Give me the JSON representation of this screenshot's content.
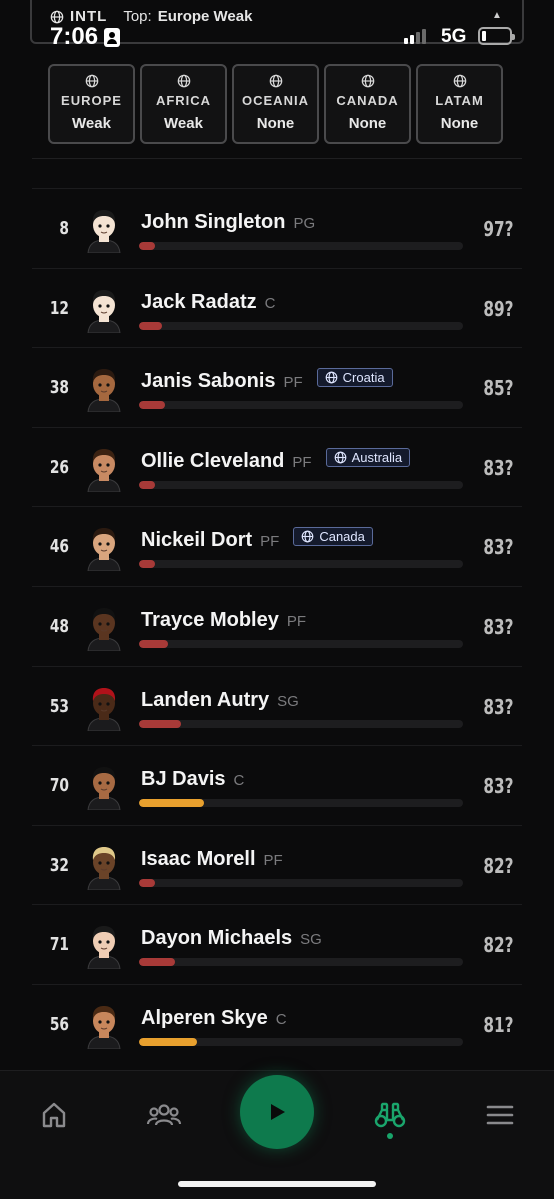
{
  "status": {
    "region": "INTL",
    "top_label": "Top:",
    "top_value": "Europe Weak",
    "time": "7:06",
    "network": "5G"
  },
  "regions": [
    {
      "name": "EUROPE",
      "state": "Weak"
    },
    {
      "name": "AFRICA",
      "state": "Weak"
    },
    {
      "name": "OCEANIA",
      "state": "None"
    },
    {
      "name": "CANADA",
      "state": "None"
    },
    {
      "name": "LATAM",
      "state": "None"
    }
  ],
  "colors": {
    "bar_red": "#a83a38",
    "bar_gold": "#e8a02e",
    "accent_green": "#0e7a4d"
  },
  "players": [
    {
      "rank": "8",
      "name": "John Singleton",
      "pos": "PG",
      "country": "",
      "ovr": "97?",
      "progress": 0.05,
      "bar": "red",
      "skin": "#f4e3d3",
      "hair": "#1a1a1a"
    },
    {
      "rank": "12",
      "name": "Jack Radatz",
      "pos": "C",
      "country": "",
      "ovr": "89?",
      "progress": 0.07,
      "bar": "red",
      "skin": "#f4e3d3",
      "hair": "#1a1a1a"
    },
    {
      "rank": "38",
      "name": "Janis Sabonis",
      "pos": "PF",
      "country": "Croatia",
      "ovr": "85?",
      "progress": 0.08,
      "bar": "red",
      "skin": "#a5683f",
      "hair": "#2b1a10"
    },
    {
      "rank": "26",
      "name": "Ollie Cleveland",
      "pos": "PF",
      "country": "Australia",
      "ovr": "83?",
      "progress": 0.05,
      "bar": "red",
      "skin": "#c88a63",
      "hair": "#3b2212"
    },
    {
      "rank": "46",
      "name": "Nickeil Dort",
      "pos": "PF",
      "country": "Canada",
      "ovr": "83?",
      "progress": 0.05,
      "bar": "red",
      "skin": "#d9a57e",
      "hair": "#2b1a10"
    },
    {
      "rank": "48",
      "name": "Trayce Mobley",
      "pos": "PF",
      "country": "",
      "ovr": "83?",
      "progress": 0.09,
      "bar": "red",
      "skin": "#5a3520",
      "hair": "#111"
    },
    {
      "rank": "53",
      "name": "Landen Autry",
      "pos": "SG",
      "country": "",
      "ovr": "83?",
      "progress": 0.13,
      "bar": "red",
      "skin": "#4a2a18",
      "hair": "#b1121a"
    },
    {
      "rank": "70",
      "name": "BJ Davis",
      "pos": "C",
      "country": "",
      "ovr": "83?",
      "progress": 0.2,
      "bar": "gold",
      "skin": "#a76a43",
      "hair": "#111"
    },
    {
      "rank": "32",
      "name": "Isaac Morell",
      "pos": "PF",
      "country": "",
      "ovr": "82?",
      "progress": 0.05,
      "bar": "red",
      "skin": "#6a4328",
      "hair": "#e0c98a"
    },
    {
      "rank": "71",
      "name": "Dayon Michaels",
      "pos": "SG",
      "country": "",
      "ovr": "82?",
      "progress": 0.11,
      "bar": "red",
      "skin": "#efcdb4",
      "hair": "#1a1a1a"
    },
    {
      "rank": "56",
      "name": "Alperen Skye",
      "pos": "C",
      "country": "",
      "ovr": "81?",
      "progress": 0.18,
      "bar": "gold",
      "skin": "#c8875c",
      "hair": "#4a2a14"
    }
  ],
  "nav": {
    "items": [
      {
        "icon": "home-icon"
      },
      {
        "icon": "team-icon"
      },
      {
        "icon": "play-icon"
      },
      {
        "icon": "binoculars-icon",
        "active": true
      },
      {
        "icon": "menu-icon"
      }
    ]
  }
}
